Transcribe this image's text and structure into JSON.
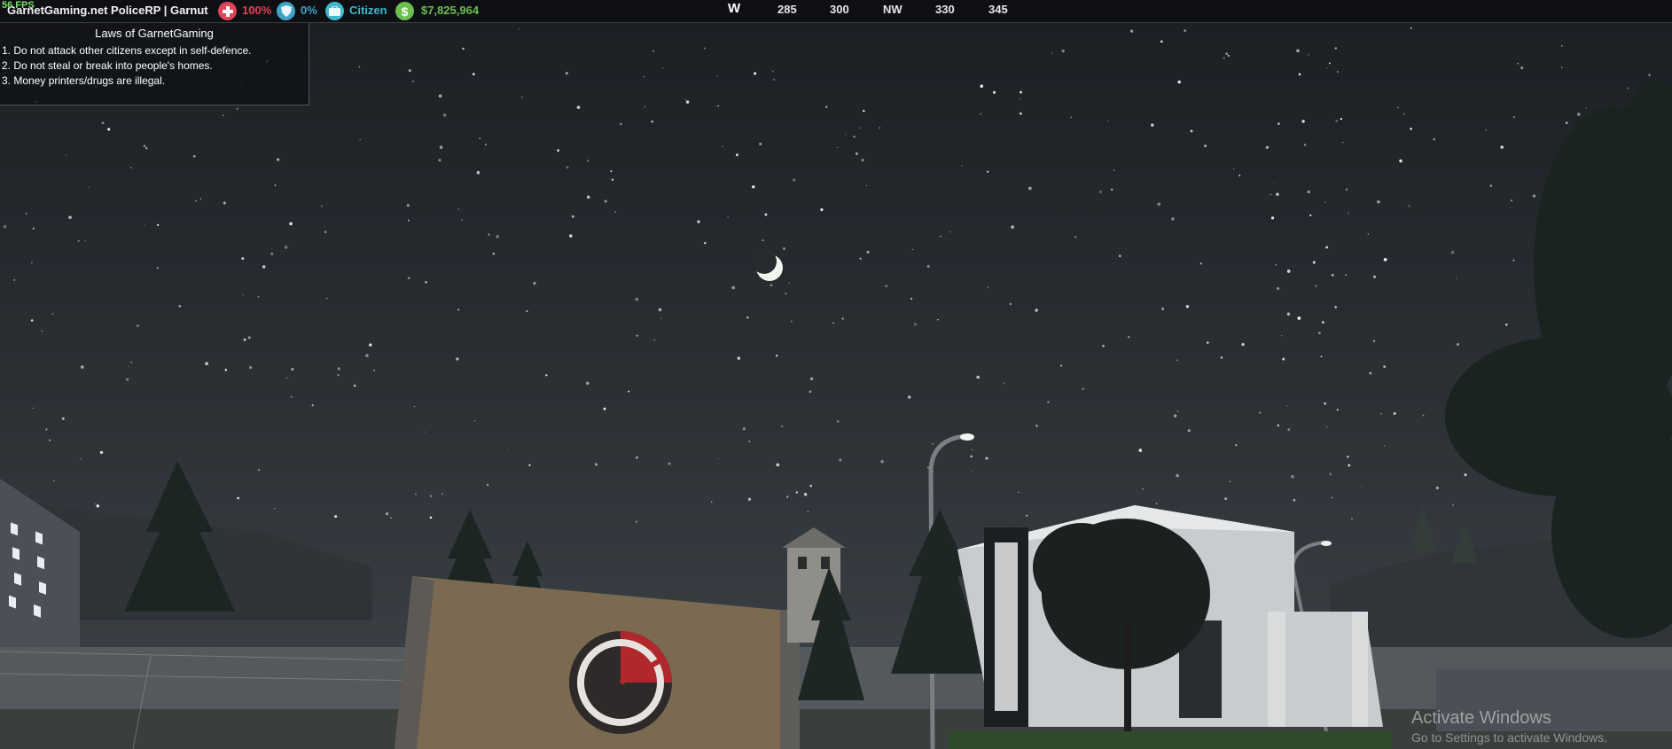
{
  "hud": {
    "fps": "56 FPS",
    "server_name": "GarnetGaming.net PoliceRP  | Garnut",
    "health": "100%",
    "armor": "0%",
    "job": "Citizen",
    "money": "$7,825,964"
  },
  "compass": {
    "marks": [
      "W",
      "285",
      "300",
      "NW",
      "330",
      "345"
    ]
  },
  "laws": {
    "title": "Laws of GarnetGaming",
    "items": [
      "1. Do not attack other citizens except in self-defence.",
      "2. Do not steal or break into people's homes.",
      "3. Money printers/drugs are illegal."
    ]
  },
  "watermark": {
    "title": "Activate Windows",
    "subtitle": "Go to Settings to activate Windows."
  },
  "colors": {
    "health": "#e0435a",
    "armor": "#3fa3c9",
    "job": "#3fb8d0",
    "money": "#6bbf4e",
    "fps": "#7be36a"
  },
  "icons": [
    "health-cross-icon",
    "armor-shield-icon",
    "job-briefcase-icon",
    "money-dollar-icon"
  ]
}
